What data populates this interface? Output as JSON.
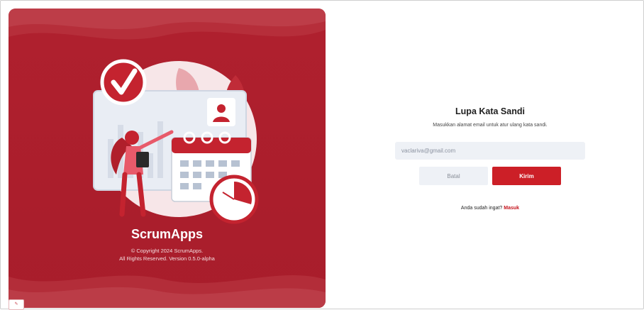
{
  "brand": {
    "app_name": "ScrumApps",
    "copyright_line1": "© Copyright 2024 ScrumApps.",
    "copyright_line2": "All Rights Reserved. Version 0.5.0-alpha",
    "colors": {
      "panel": "#b0202e",
      "accent": "#cc1f27"
    }
  },
  "form": {
    "title": "Lupa Kata Sandi",
    "subtitle": "Masukkan alamat email untuk atur ulang kata sandi.",
    "email_value": "vaclariva@gmail.com",
    "cancel_label": "Batal",
    "submit_label": "Kirim",
    "remember_text": "Anda sudah ingat?",
    "login_link": "Masuk"
  }
}
